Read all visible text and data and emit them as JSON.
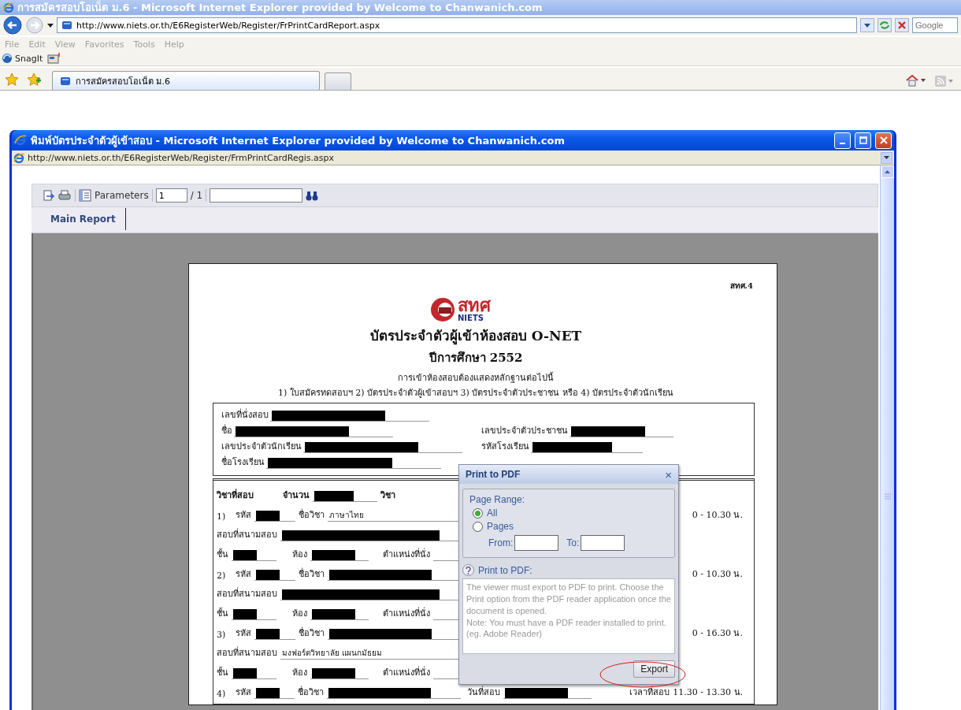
{
  "browser": {
    "title": "การสมัครสอบโอเน็ต ม.6 - Microsoft Internet Explorer provided by Welcome to Chanwanich.com",
    "address": "http://www.niets.or.th/E6RegisterWeb/Register/FrPrintCardReport.aspx",
    "search_placeholder": "Google",
    "menu": [
      "File",
      "Edit",
      "View",
      "Favorites",
      "Tools",
      "Help"
    ],
    "toolbar": [
      "SnagIt"
    ],
    "tabs": [
      {
        "label": "การสมัครสอบโอเน็ต ม.6",
        "selected": true
      }
    ]
  },
  "popup": {
    "title": "พิมพ์บัตรประจำตัวผู้เข้าสอบ - Microsoft Internet Explorer provided by Welcome to Chanwanich.com",
    "address": "http://www.niets.or.th/E6RegisterWeb/Register/FrmPrintCardRegis.aspx",
    "viewer": {
      "parameters": "Parameters",
      "page": "1",
      "page_total": "/ 1",
      "tabs": [
        {
          "label": "Main Report",
          "selected": true
        }
      ],
      "document": {
        "form_code": "สทศ.4",
        "logo": {
          "thai": "สทศ",
          "english": "NIETS"
        },
        "title": "บัตรประจำตัวผู้เข้าห้องสอบ O-NET",
        "year": "ปีการศึกษา 2552",
        "notice": "การเข้าห้องสอบต้องแสดงหลักฐานต่อไปนี้",
        "requirements": "1) ใบสมัครทดสอบฯ 2) บัตรประจำตัวผู้เข้าสอบฯ 3) บัตรประจำตัวประชาชน หรือ 4) บัตรประจำตัวนักเรียน",
        "candidate": [
          {
            "fields": [
              {
                "label": "เลขที่นั่งสอบ",
                "redacted": true
              }
            ]
          },
          {
            "fields": [
              {
                "label": "ชื่อ",
                "redacted": true
              },
              {
                "label": "เลขประจำตัวประชาชน",
                "redacted": true
              }
            ]
          },
          {
            "fields": [
              {
                "label": "เลขประจำตัวนักเรียน",
                "redacted": true
              },
              {
                "label": "รหัสโรงเรียน",
                "redacted": true
              }
            ]
          },
          {
            "fields": [
              {
                "label": "ชื่อโรงเรียน",
                "redacted": true
              }
            ]
          }
        ],
        "subjects": {
          "label": "วิชาที่สอบ",
          "count_label": "จำนวน",
          "count": {
            "redacted": true
          },
          "unit": "วิชา",
          "items": [
            {
              "number": "1)",
              "code_label": "รหัส",
              "code": {
                "redacted": true
              },
              "name_label": "ชื่อวิชา",
              "name": {
                "redacted": false,
                "value": "ภาษาไทย"
              },
              "time": "0 - 10.30 น.",
              "venue_label": "สอบที่สนามสอบ",
              "venue": {
                "redacted": true
              },
              "level_label": "ชั้น",
              "level": {
                "redacted": true
              },
              "room_label": "ห้อง",
              "room": {
                "redacted": true
              },
              "seat_label": "ตำแหน่งที่นั่ง"
            },
            {
              "number": "2)",
              "code_label": "รหัส",
              "code": {
                "redacted": true
              },
              "name_label": "ชื่อวิชา",
              "name": {
                "redacted": true
              },
              "time": "0 - 10.30 น.",
              "venue_label": "สอบที่สนามสอบ",
              "venue": {
                "redacted": true
              },
              "level_label": "ชั้น",
              "level": {
                "redacted": true
              },
              "room_label": "ห้อง",
              "room": {
                "redacted": true
              },
              "seat_label": "ตำแหน่งที่นั่ง"
            },
            {
              "number": "3)",
              "code_label": "รหัส",
              "code": {
                "redacted": true
              },
              "name_label": "ชื่อวิชา",
              "name": {
                "redacted": true
              },
              "time": "0 - 16.30 น.",
              "venue_label": "สอบที่สนามสอบ",
              "venue": {
                "redacted": false,
                "value": "มงฟอร์ตวิทยาลัย แผนกมัธยม"
              },
              "level_label": "ชั้น",
              "level": {
                "redacted": true
              },
              "room_label": "ห้อง",
              "room": {
                "redacted": true
              },
              "seat_label": "ตำแหน่งที่นั่ง"
            },
            {
              "number": "4)",
              "code_label": "รหัส",
              "code": {
                "redacted": true
              },
              "name_label": "ชื่อวิชา",
              "name": {
                "redacted": true
              },
              "date_label": "วันที่สอบ",
              "date": {
                "redacted": true
              },
              "time_label": "เวลาที่สอบ",
              "time": "11.30 - 13.30 น."
            }
          ]
        }
      }
    }
  },
  "dialog": {
    "title": "Print to PDF",
    "close": "×",
    "range_label": "Page Range:",
    "radios": [
      {
        "label": "All",
        "selected": true
      },
      {
        "label": "Pages",
        "selected": false
      }
    ],
    "from_label": "From:",
    "to_label": "To:",
    "help_title": "Print to PDF:",
    "help_text": [
      "The viewer must export to PDF to print. Choose the Print option from the PDF reader application once the document is opened.",
      "Note: You must have a PDF reader installed to print. (eg. Adobe Reader)"
    ],
    "button": "Export"
  }
}
